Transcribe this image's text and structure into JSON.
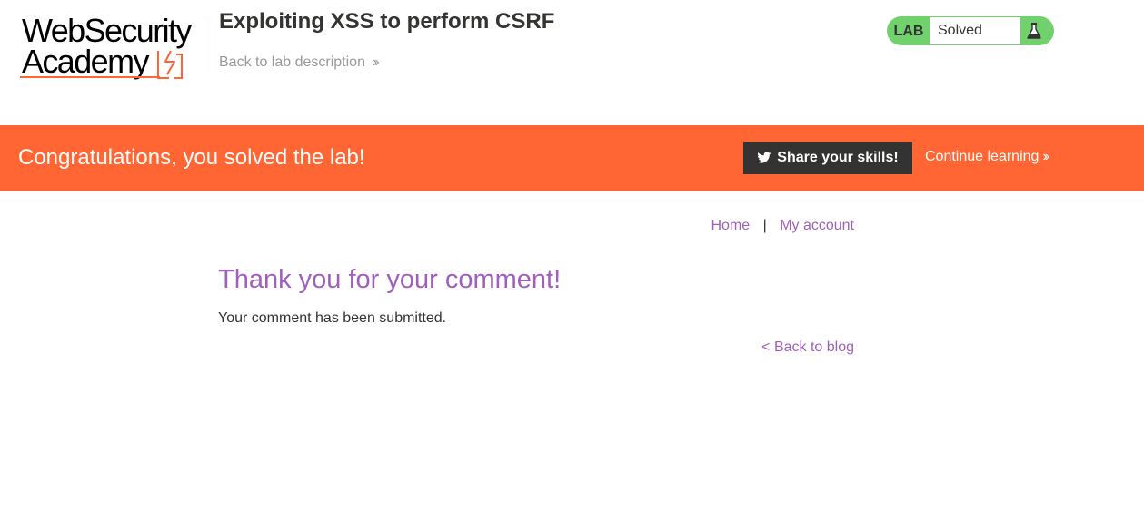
{
  "header": {
    "logo_line1": "WebSecurity",
    "logo_line2": "Academy",
    "lab_title": "Exploiting XSS to perform CSRF",
    "back_to_description": "Back to lab description",
    "lab_tag": "LAB",
    "lab_status": "Solved"
  },
  "banner": {
    "message": "Congratulations, you solved the lab!",
    "share_label": "Share your skills!",
    "continue_label": "Continue learning"
  },
  "nav": {
    "home": "Home",
    "separator": "|",
    "my_account": "My account"
  },
  "main": {
    "heading": "Thank you for your comment!",
    "message": "Your comment has been submitted.",
    "back_to_blog": "< Back to blog"
  },
  "icons": {
    "logo_zap": "lightning-bolt-icon",
    "flask": "flask-icon",
    "twitter": "twitter-icon",
    "chevrons": "double-chevron-right-icon"
  },
  "colors": {
    "accent_orange": "#ff6633",
    "solved_green": "#70d16d",
    "link_purple": "#a05fbd",
    "dark": "#333332"
  }
}
